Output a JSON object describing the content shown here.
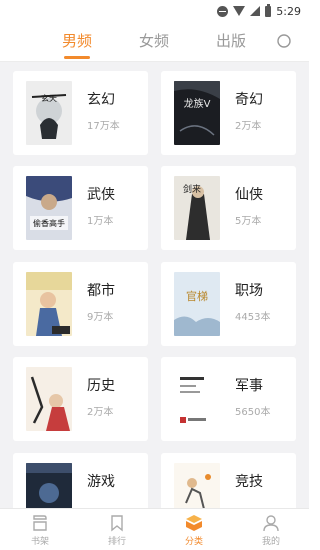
{
  "status_bar": {
    "time": "5:29"
  },
  "tabs": [
    {
      "label": "男频",
      "active": true
    },
    {
      "label": "女频",
      "active": false
    },
    {
      "label": "出版",
      "active": false
    }
  ],
  "search": {
    "icon": "search-icon"
  },
  "categories": [
    {
      "name": "玄幻",
      "count": "17万本",
      "cover_title": "玄天"
    },
    {
      "name": "奇幻",
      "count": "2万本",
      "cover_title": "龙族V"
    },
    {
      "name": "武侠",
      "count": "1万本",
      "cover_title": "偷香高手"
    },
    {
      "name": "仙侠",
      "count": "5万本",
      "cover_title": "剑来"
    },
    {
      "name": "都市",
      "count": "9万本",
      "cover_title": ""
    },
    {
      "name": "职场",
      "count": "4453本",
      "cover_title": "官梯"
    },
    {
      "name": "历史",
      "count": "2万本",
      "cover_title": ""
    },
    {
      "name": "军事",
      "count": "5650本",
      "cover_title": ""
    },
    {
      "name": "游戏",
      "count": "",
      "cover_title": ""
    },
    {
      "name": "竞技",
      "count": "",
      "cover_title": ""
    }
  ],
  "bottom_nav": [
    {
      "label": "书架",
      "icon": "bookshelf-icon",
      "active": false
    },
    {
      "label": "排行",
      "icon": "ranking-icon",
      "active": false
    },
    {
      "label": "分类",
      "icon": "category-icon",
      "active": true
    },
    {
      "label": "我的",
      "icon": "profile-icon",
      "active": false
    }
  ],
  "colors": {
    "accent": "#f28a2c",
    "background": "#f2f2f4"
  }
}
